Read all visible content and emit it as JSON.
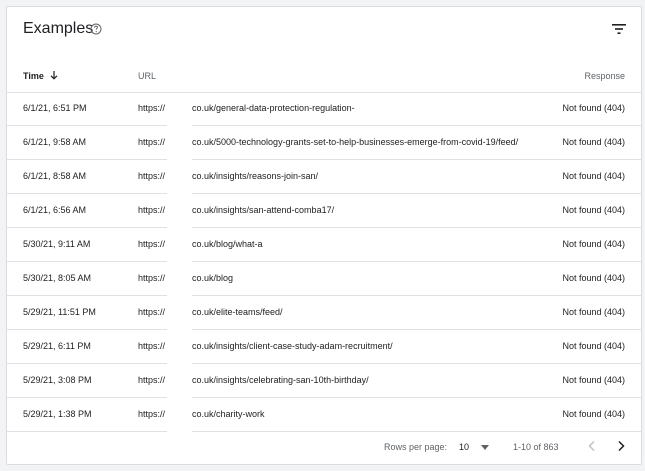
{
  "header": {
    "title": "Examples",
    "help_icon": "help-circle-icon",
    "filter_icon": "filter-icon"
  },
  "table": {
    "columns": {
      "time": "Time",
      "url": "URL",
      "response": "Response"
    },
    "sort_icon": "arrow-down-icon",
    "rows": [
      {
        "time": "6/1/21, 6:51 PM",
        "url_scheme": "https://",
        "url_path": "co.uk/general-data-protection-regulation-",
        "response": "Not found (404)"
      },
      {
        "time": "6/1/21, 9:58 AM",
        "url_scheme": "https://",
        "url_path": "co.uk/5000-technology-grants-set-to-help-businesses-emerge-from-covid-19/feed/",
        "response": "Not found (404)"
      },
      {
        "time": "6/1/21, 8:58 AM",
        "url_scheme": "https://",
        "url_path": "co.uk/insights/reasons-join-san/",
        "response": "Not found (404)"
      },
      {
        "time": "6/1/21, 6:56 AM",
        "url_scheme": "https://",
        "url_path": "co.uk/insights/san-attend-comba17/",
        "response": "Not found (404)"
      },
      {
        "time": "5/30/21, 9:11 AM",
        "url_scheme": "https://",
        "url_path": "co.uk/blog/what-a",
        "response": "Not found (404)"
      },
      {
        "time": "5/30/21, 8:05 AM",
        "url_scheme": "https://",
        "url_path": "co.uk/blog",
        "response": "Not found (404)"
      },
      {
        "time": "5/29/21, 11:51 PM",
        "url_scheme": "https://",
        "url_path": "co.uk/elite-teams/feed/",
        "response": "Not found (404)"
      },
      {
        "time": "5/29/21, 6:11 PM",
        "url_scheme": "https://",
        "url_path": "co.uk/insights/client-case-study-adam-recruitment/",
        "response": "Not found (404)"
      },
      {
        "time": "5/29/21, 3:08 PM",
        "url_scheme": "https://",
        "url_path": "co.uk/insights/celebrating-san-10th-birthday/",
        "response": "Not found (404)"
      },
      {
        "time": "5/29/21, 1:38 PM",
        "url_scheme": "https://",
        "url_path": "co.uk/charity-work",
        "response": "Not found (404)"
      }
    ]
  },
  "footer": {
    "rows_per_page_label": "Rows per page:",
    "rows_per_page_value": "10",
    "range": "1-10 of 863",
    "prev_icon": "chevron-left-icon",
    "next_icon": "chevron-right-icon"
  },
  "colors": {
    "text": "#202124",
    "secondary_text": "#5f6368",
    "divider": "#e0e0e0",
    "disabled_icon": "#bdc1c6"
  }
}
